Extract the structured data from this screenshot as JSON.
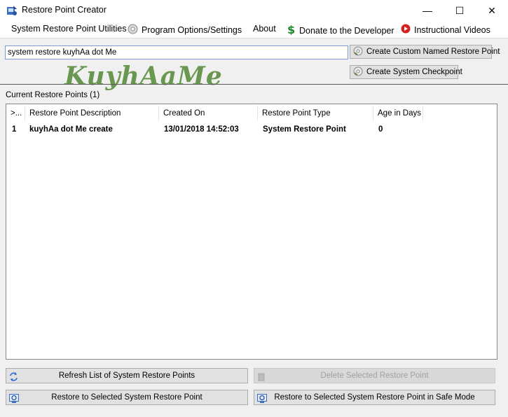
{
  "window": {
    "title": "Restore Point Creator",
    "minimize": "—",
    "maximize": "☐",
    "close": "✕"
  },
  "menu": {
    "utilities": "System Restore Point Utilities",
    "options": "Program Options/Settings",
    "about": "About",
    "donate": "Donate to the Developer",
    "videos": "Instructional Videos"
  },
  "name_input": {
    "value": "system restore kuyhAa dot Me"
  },
  "buttons": {
    "create_custom": "Create Custom Named Restore Point",
    "create_checkpoint": "Create System Checkpoint",
    "refresh": "Refresh List of System Restore Points",
    "delete": "Delete Selected Restore Point",
    "restore": "Restore to Selected System Restore Point",
    "restore_safe": "Restore to Selected System Restore Point in Safe Mode"
  },
  "watermark": "KuyhAaMe",
  "list": {
    "label": "Current Restore Points (1)",
    "columns": [
      ">...",
      "Restore Point Description",
      "Created On",
      "Restore Point Type",
      "Age in Days"
    ],
    "rows": [
      [
        "1",
        "kuyhAa dot Me create",
        "13/01/2018 14:52:03",
        "System Restore Point",
        "0"
      ]
    ]
  },
  "icons": {
    "app": "restore-point-app-icon",
    "options": "gear-disc-icon",
    "donate": "dollar-icon",
    "videos": "play-icon",
    "create": "disc-icon",
    "refresh": "refresh-arrows-icon",
    "delete": "trash-icon",
    "restore": "restore-icon"
  }
}
